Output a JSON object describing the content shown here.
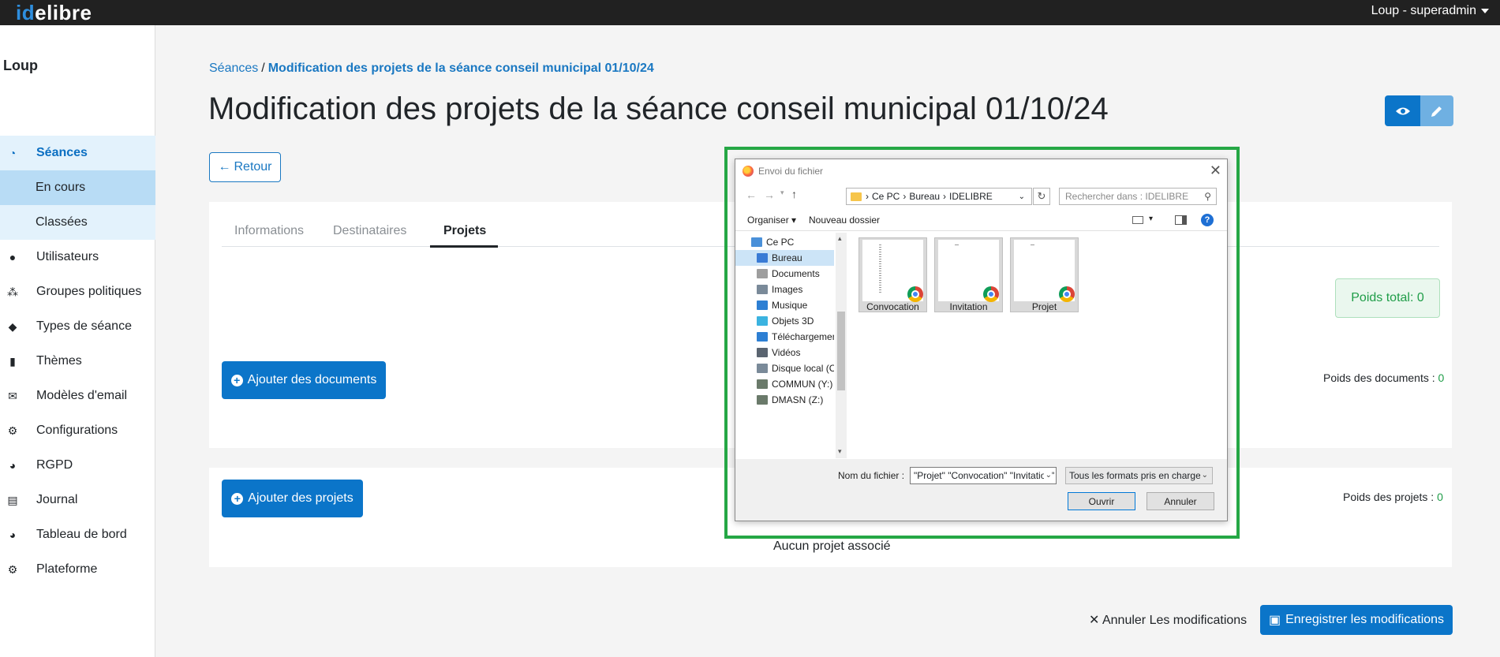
{
  "header": {
    "logo_part1": "id",
    "logo_part2": "elibre",
    "user": "Loup - superadmin"
  },
  "sidebar": {
    "org": "Loup",
    "items": [
      {
        "label": "Séances",
        "icon": "gauge-icon"
      },
      {
        "label": "En cours"
      },
      {
        "label": "Classées"
      },
      {
        "label": "Utilisateurs",
        "icon": "user-icon"
      },
      {
        "label": "Groupes politiques",
        "icon": "users-icon"
      },
      {
        "label": "Types de séance",
        "icon": "tag-icon"
      },
      {
        "label": "Thèmes",
        "icon": "book-icon"
      },
      {
        "label": "Modèles d'email",
        "icon": "envelope-icon"
      },
      {
        "label": "Configurations",
        "icon": "gear-icon"
      },
      {
        "label": "RGPD",
        "icon": "dashboard-icon"
      },
      {
        "label": "Journal",
        "icon": "newspaper-icon"
      },
      {
        "label": "Tableau de bord",
        "icon": "dashboard-icon"
      },
      {
        "label": "Plateforme",
        "icon": "gears-icon"
      }
    ]
  },
  "breadcrumb": {
    "parent": "Séances",
    "separator": "/",
    "current": "Modification des projets de la séance conseil municipal 01/10/24"
  },
  "page": {
    "title": "Modification des projets de la séance conseil municipal 01/10/24",
    "back": "Retour",
    "tabs": [
      "Informations",
      "Destinataires",
      "Projets"
    ],
    "active_tab": "Projets",
    "weight_total": "Poids total: 0",
    "add_documents": "Ajouter des documents",
    "documents_weight_label": "Poids des documents : ",
    "documents_weight_value": "0",
    "add_projects": "Ajouter des projets",
    "projects_weight_label": "Poids des projets : ",
    "projects_weight_value": "0",
    "no_projects": "Aucun projet associé",
    "cancel": "Annuler Les modifications",
    "save": "Enregistrer les modifications"
  },
  "dialog": {
    "title": "Envoi du fichier",
    "path": [
      "Ce PC",
      "Bureau",
      "IDELIBRE"
    ],
    "search_placeholder": "Rechercher dans : IDELIBRE",
    "organize": "Organiser",
    "new_folder": "Nouveau dossier",
    "tree": [
      {
        "label": "Ce PC",
        "color": "#4a90d9"
      },
      {
        "label": "Bureau",
        "color": "#3a7bd5",
        "selected": true
      },
      {
        "label": "Documents",
        "color": "#9e9e9e"
      },
      {
        "label": "Images",
        "color": "#7a8a99"
      },
      {
        "label": "Musique",
        "color": "#2d7fd3"
      },
      {
        "label": "Objets 3D",
        "color": "#3bb3e0"
      },
      {
        "label": "Téléchargements",
        "color": "#2d7fd3"
      },
      {
        "label": "Vidéos",
        "color": "#5a6470"
      },
      {
        "label": "Disque local (C:)",
        "color": "#7a8a99"
      },
      {
        "label": "COMMUN (Y:)",
        "color": "#6a7a6a"
      },
      {
        "label": "DMASN (Z:)",
        "color": "#6a7a6a"
      }
    ],
    "files": [
      "Convocation",
      "Invitation",
      "Projet"
    ],
    "filename_label": "Nom du fichier :",
    "filename_value": "\"Projet\" \"Convocation\" \"Invitation\"",
    "filter": "Tous les formats pris en charge",
    "open": "Ouvrir",
    "cancel": "Annuler"
  },
  "colors": {
    "primary": "#0b75c9",
    "success": "#1f9d48",
    "highlight": "#25a745"
  }
}
